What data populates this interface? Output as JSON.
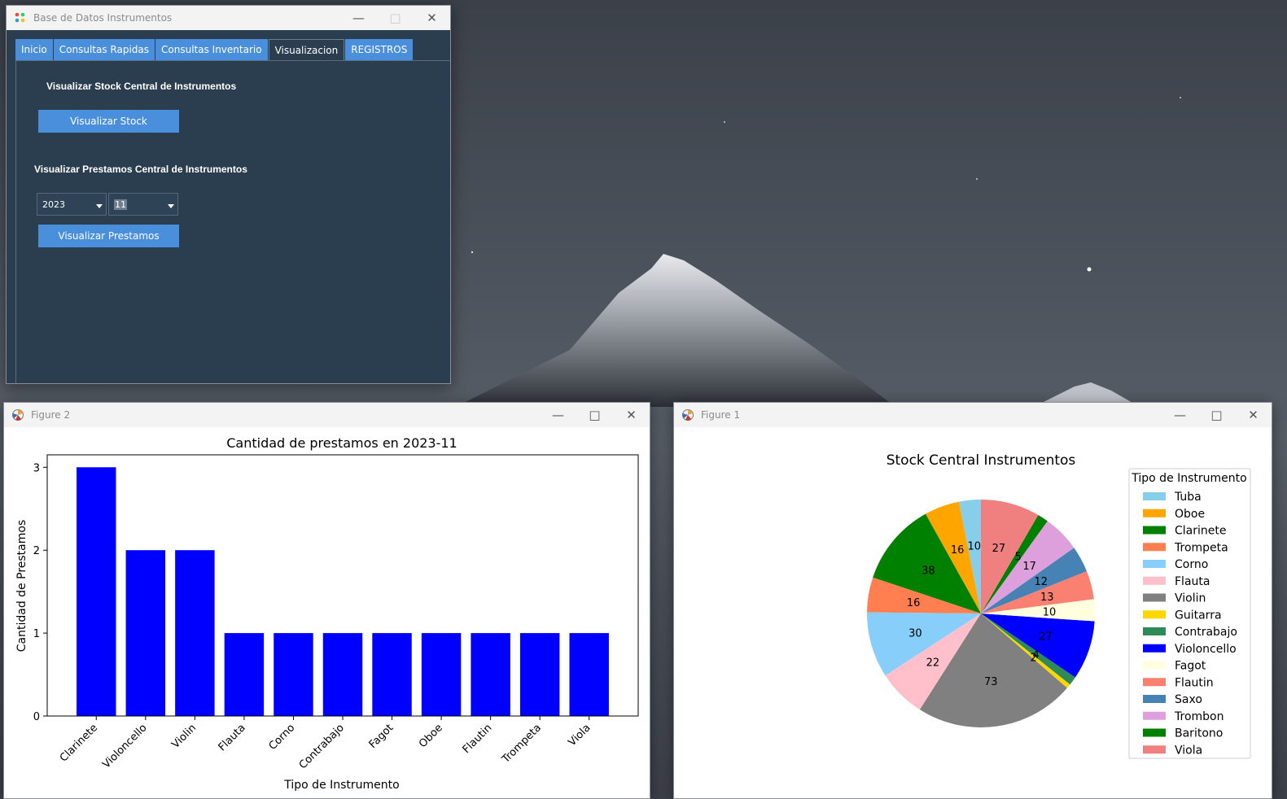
{
  "main_window": {
    "title": "Base de Datos Instrumentos",
    "tabs": [
      {
        "label": "Inicio"
      },
      {
        "label": "Consultas Rapidas"
      },
      {
        "label": "Consultas Inventario"
      },
      {
        "label": "Visualizacion"
      },
      {
        "label": "REGISTROS"
      }
    ],
    "active_tab": "Visualizacion",
    "stock_heading": "Visualizar Stock Central de Instrumentos",
    "stock_button": "Visualizar Stock",
    "loans_heading": "Visualizar Prestamos Central de Instrumentos",
    "year_select": "2023",
    "month_select": "11",
    "loans_button": "Visualizar Prestamos",
    "colors": {
      "panel_bg": "#2b3e50",
      "accent": "#4a8fdc"
    }
  },
  "figure2": {
    "title": "Figure 2",
    "chart_data": {
      "type": "bar",
      "title": "Cantidad de prestamos en 2023-11",
      "xlabel": "Tipo de Instrumento",
      "ylabel": "Cantidad de Prestamos",
      "categories": [
        "Clarinete",
        "Violoncello",
        "Violin",
        "Flauta",
        "Corno",
        "Contrabajo",
        "Fagot",
        "Oboe",
        "Flautin",
        "Trompeta",
        "Viola"
      ],
      "values": [
        3,
        2,
        2,
        1,
        1,
        1,
        1,
        1,
        1,
        1,
        1
      ],
      "yticks": [
        "0",
        "1",
        "2",
        "3"
      ],
      "ylim": [
        0,
        3.15
      ],
      "color": "#0000ff"
    }
  },
  "figure1": {
    "title": "Figure 1",
    "chart_data": {
      "type": "pie",
      "title": "Stock Central Instrumentos",
      "legend_title": "Tipo de Instrumento",
      "legend_placement": "right",
      "slices": [
        {
          "label": "Tuba",
          "value": 10,
          "color": "#87ceeb"
        },
        {
          "label": "Oboe",
          "value": 16,
          "color": "#ffa500"
        },
        {
          "label": "Clarinete",
          "value": 38,
          "color": "#008000"
        },
        {
          "label": "Trompeta",
          "value": 16,
          "color": "#ff7f50"
        },
        {
          "label": "Corno",
          "value": 30,
          "color": "#87cefa"
        },
        {
          "label": "Flauta",
          "value": 22,
          "color": "#ffc0cb"
        },
        {
          "label": "Violin",
          "value": 73,
          "color": "#808080"
        },
        {
          "label": "Guitarra",
          "value": 2,
          "color": "#ffd700"
        },
        {
          "label": "Contrabajo",
          "value": 4,
          "color": "#2e8b57"
        },
        {
          "label": "Violoncello",
          "value": 27,
          "color": "#0000ff"
        },
        {
          "label": "Fagot",
          "value": 10,
          "color": "#ffffe0"
        },
        {
          "label": "Flautin",
          "value": 13,
          "color": "#fa8072"
        },
        {
          "label": "Saxo",
          "value": 12,
          "color": "#4682b4"
        },
        {
          "label": "Trombon",
          "value": 17,
          "color": "#dda0dd"
        },
        {
          "label": "Baritono",
          "value": 5,
          "color": "#008000"
        },
        {
          "label": "Viola",
          "value": 27,
          "color": "#f08080"
        }
      ],
      "value_labels": [
        "10",
        "16",
        "38",
        "16",
        "30",
        "22",
        "73",
        "2",
        "4",
        "27",
        "10",
        "13",
        "12",
        "17",
        "5",
        "27"
      ]
    }
  }
}
